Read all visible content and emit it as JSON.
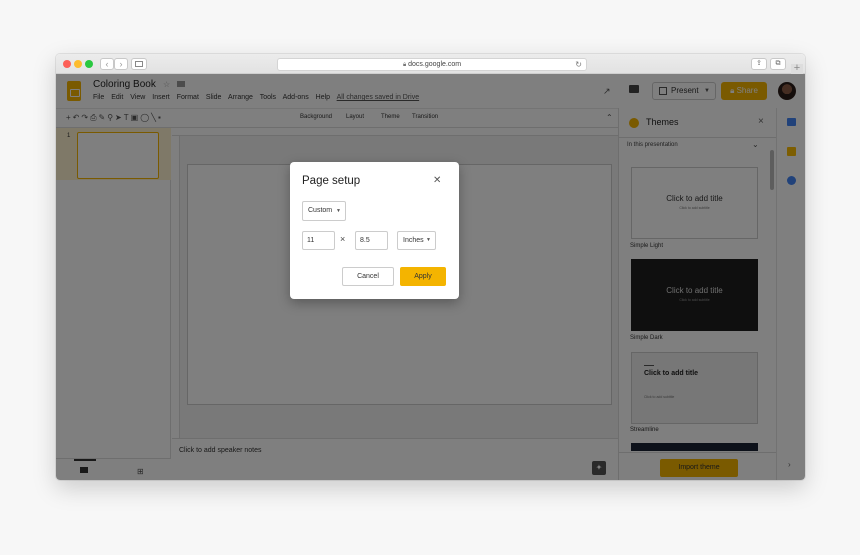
{
  "browser": {
    "url": "docs.google.com",
    "nav_back": "‹",
    "nav_forward": "›",
    "new_tab": "+"
  },
  "app": {
    "doc_title": "Coloring Book",
    "menu": [
      "File",
      "Edit",
      "View",
      "Insert",
      "Format",
      "Slide",
      "Arrange",
      "Tools",
      "Add-ons",
      "Help"
    ],
    "saved_status": "All changes saved in Drive",
    "present_label": "Present",
    "share_label": "Share",
    "toolbar": {
      "background": "Background",
      "layout": "Layout",
      "theme": "Theme",
      "transition": "Transition"
    },
    "filmstrip": {
      "slide_number": "1"
    },
    "notes_placeholder": "Click to add speaker notes"
  },
  "themes": {
    "title": "Themes",
    "scope": "In this presentation",
    "items": [
      {
        "name": "Simple Light",
        "title": "Click to add title",
        "subtitle": "Click to add subtitle"
      },
      {
        "name": "Simple Dark",
        "title": "Click to add title",
        "subtitle": "Click to add subtitle"
      },
      {
        "name": "Streamline",
        "title": "Click to add title",
        "subtitle": "Click to add subtitle"
      }
    ],
    "import_label": "Import theme"
  },
  "dialog": {
    "title": "Page setup",
    "size_preset": "Custom",
    "width": "11",
    "height": "8.5",
    "times": "×",
    "unit": "Inches",
    "cancel_label": "Cancel",
    "apply_label": "Apply"
  },
  "colors": {
    "accent": "#f4b400",
    "overlay": "rgba(0,0,0,0.5)"
  }
}
